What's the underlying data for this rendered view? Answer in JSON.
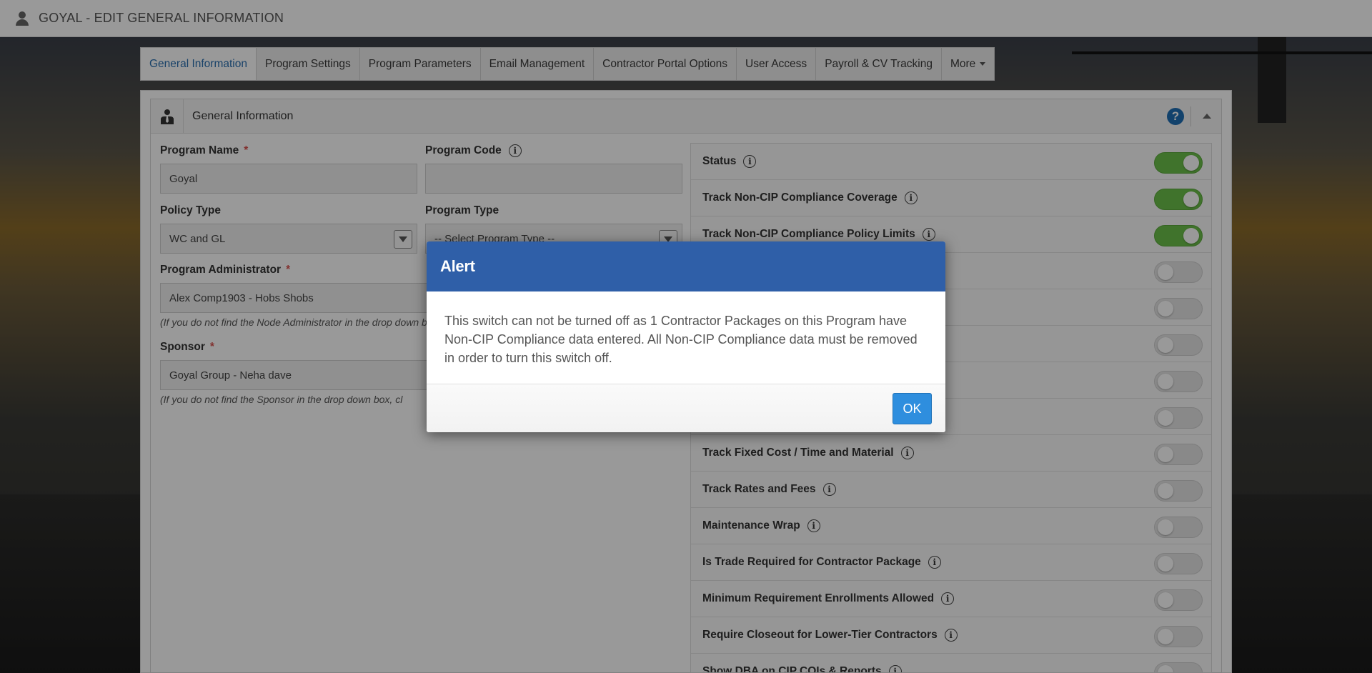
{
  "header": {
    "title": "GOYAL - EDIT GENERAL INFORMATION"
  },
  "tabs": [
    {
      "label": "General Information",
      "active": true
    },
    {
      "label": "Program Settings"
    },
    {
      "label": "Program Parameters"
    },
    {
      "label": "Email Management"
    },
    {
      "label": "Contractor Portal Options"
    },
    {
      "label": "User Access"
    },
    {
      "label": "Payroll & CV Tracking"
    },
    {
      "label": "More"
    }
  ],
  "panel": {
    "title": "General Information",
    "help": "?"
  },
  "form": {
    "program_name": {
      "label": "Program Name",
      "required": "*",
      "value": "Goyal"
    },
    "program_code": {
      "label": "Program Code",
      "value": ""
    },
    "policy_type": {
      "label": "Policy Type",
      "value": "WC and GL"
    },
    "program_type": {
      "label": "Program Type",
      "value": "-- Select Program Type --"
    },
    "program_admin": {
      "label": "Program Administrator",
      "required": "*",
      "value": "Alex Comp1903 - Hobs Shobs",
      "hint": "(If you do not find the Node Administrator in the drop down box, click"
    },
    "sponsor": {
      "label": "Sponsor",
      "required": "*",
      "value": "Goyal Group - Neha dave",
      "hint": "(If you do not find the Sponsor in the drop down box,  cl"
    }
  },
  "switches": [
    {
      "label": "Status",
      "on": true
    },
    {
      "label": "Track Non-CIP Compliance Coverage",
      "on": true
    },
    {
      "label": "Track Non-CIP Compliance Policy Limits",
      "on": true
    },
    {
      "label": "",
      "on": false
    },
    {
      "label": "",
      "on": false
    },
    {
      "label": "",
      "on": false
    },
    {
      "label": "",
      "on": false
    },
    {
      "label": "",
      "on": false
    },
    {
      "label": "Track Fixed Cost / Time and Material",
      "on": false
    },
    {
      "label": "Track Rates and Fees",
      "on": false
    },
    {
      "label": "Maintenance Wrap",
      "on": false
    },
    {
      "label": "Is Trade Required for Contractor Package",
      "on": false
    },
    {
      "label": "Minimum Requirement Enrollments Allowed",
      "on": false
    },
    {
      "label": "Require Closeout for Lower-Tier Contractors",
      "on": false
    },
    {
      "label": "Show DBA on CIP COIs & Reports",
      "on": false
    }
  ],
  "modal": {
    "title": "Alert",
    "message": "This switch can not be turned off as 1 Contractor Packages on this Program have Non-CIP Compliance data entered. All Non-CIP Compliance data must be removed in order to turn this switch off.",
    "ok_label": "OK"
  },
  "colors": {
    "modal_header": "#2f5fa8",
    "ok_button": "#2e8ede",
    "toggle_on": "#6cc04a",
    "active_tab": "#2a6fb0",
    "required": "#d9534f"
  }
}
